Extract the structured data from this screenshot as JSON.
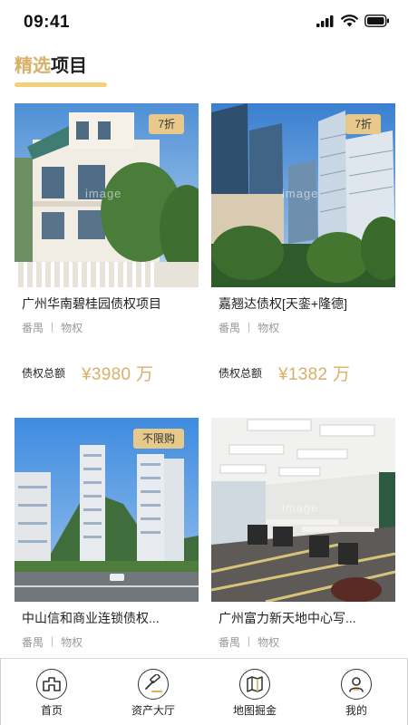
{
  "status_bar": {
    "time": "09:41",
    "icons": [
      "signal-icon",
      "wifi-icon",
      "battery-icon"
    ]
  },
  "section": {
    "title_accent": "精选",
    "title_rest": "项目",
    "accent_color": "#d8b06a"
  },
  "cards": [
    {
      "tag": "7折",
      "watermark": "image",
      "title": "广州华南碧桂园债权项目",
      "district": "番禺",
      "separator": "|",
      "category": "物权",
      "price_label": "债权总额",
      "price_value": "¥3980 万",
      "image": "villa-photo"
    },
    {
      "tag": "7折",
      "watermark": "image",
      "title": "嘉翘达债权[天銮+隆德]",
      "district": "番禺",
      "separator": "|",
      "category": "物权",
      "price_label": "债权总额",
      "price_value": "¥1382 万",
      "image": "towers-photo"
    },
    {
      "tag": "不限购",
      "title": "中山信和商业连锁债权...",
      "district": "番禺",
      "separator": "|",
      "category": "物权",
      "image": "residential-towers-photo"
    },
    {
      "watermark": "image",
      "title": "广州富力新天地中心写...",
      "district": "番禺",
      "separator": "|",
      "category": "物权",
      "image": "office-interior-photo"
    }
  ],
  "tab_bar": {
    "items": [
      {
        "label": "首页",
        "icon": "home-icon"
      },
      {
        "label": "资产大厅",
        "icon": "auction-hammer-icon"
      },
      {
        "label": "地图掘金",
        "icon": "map-icon"
      },
      {
        "label": "我的",
        "icon": "user-icon"
      }
    ]
  }
}
